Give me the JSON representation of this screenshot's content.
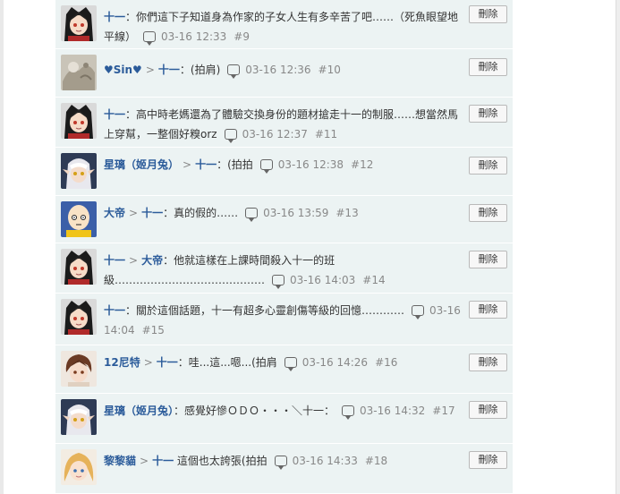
{
  "delete_label": "刪除",
  "colors": {
    "name": "#2b5b9a",
    "meta": "#888888",
    "row_bg": "#ecf3f3"
  },
  "comments": [
    {
      "avatar": "anime-girl-black-hood-avatar",
      "author": "十一",
      "reply_to": "",
      "text": "：你們這下子知道身為作家的子女人生有多辛苦了吧……（死魚眼望地平線）",
      "time": "03-16 12:33",
      "floor": "#9"
    },
    {
      "avatar": "gray-textured-avatar",
      "author": "♥Sin♥",
      "reply_to": "十一",
      "text": "：(拍肩)",
      "time": "03-16 12:36",
      "floor": "#10"
    },
    {
      "avatar": "anime-girl-black-hood-avatar",
      "author": "十一",
      "reply_to": "",
      "text": "：高中時老媽還為了體驗交換身份的題材搶走十一的制服……想當然馬上穿幫，一整個好糗orz",
      "time": "03-16 12:37",
      "floor": "#11"
    },
    {
      "avatar": "silver-hair-elf-avatar",
      "author": "星璃（姬月兔）",
      "reply_to": "十一",
      "text": "：(拍拍",
      "time": "03-16 12:38",
      "floor": "#12"
    },
    {
      "avatar": "bald-hero-avatar",
      "author": "大帝",
      "reply_to": "十一",
      "text": "：真的假的……",
      "time": "03-16 13:59",
      "floor": "#13"
    },
    {
      "avatar": "anime-girl-black-hood-avatar",
      "author": "十一",
      "reply_to": "大帝",
      "text": "：他就這樣在上課時間殺入十一的班級……………………………………",
      "time": "03-16 14:03",
      "floor": "#14"
    },
    {
      "avatar": "anime-girl-black-hood-avatar",
      "author": "十一",
      "reply_to": "",
      "text": "：關於這個話題，十一有超多心靈創傷等級的回憶…………",
      "time": "03-16 14:04",
      "floor": "#15"
    },
    {
      "avatar": "brown-hair-boy-avatar",
      "author": "12尼特",
      "reply_to": "十一",
      "text": "：哇...這...嗯...(拍肩",
      "time": "03-16 14:26",
      "floor": "#16"
    },
    {
      "avatar": "silver-hair-elf-avatar",
      "author": "星璃（姬月兔）",
      "reply_to": "",
      "text": "：感覺好慘ＯＤＯ・・・＼十一：",
      "time": "03-16 14:32",
      "floor": "#17"
    },
    {
      "avatar": "blonde-girl-avatar",
      "author": "黎黎貓",
      "reply_to": "十一",
      "text": " 這個也太誇張(拍拍",
      "time": "03-16 14:33",
      "floor": "#18"
    }
  ]
}
